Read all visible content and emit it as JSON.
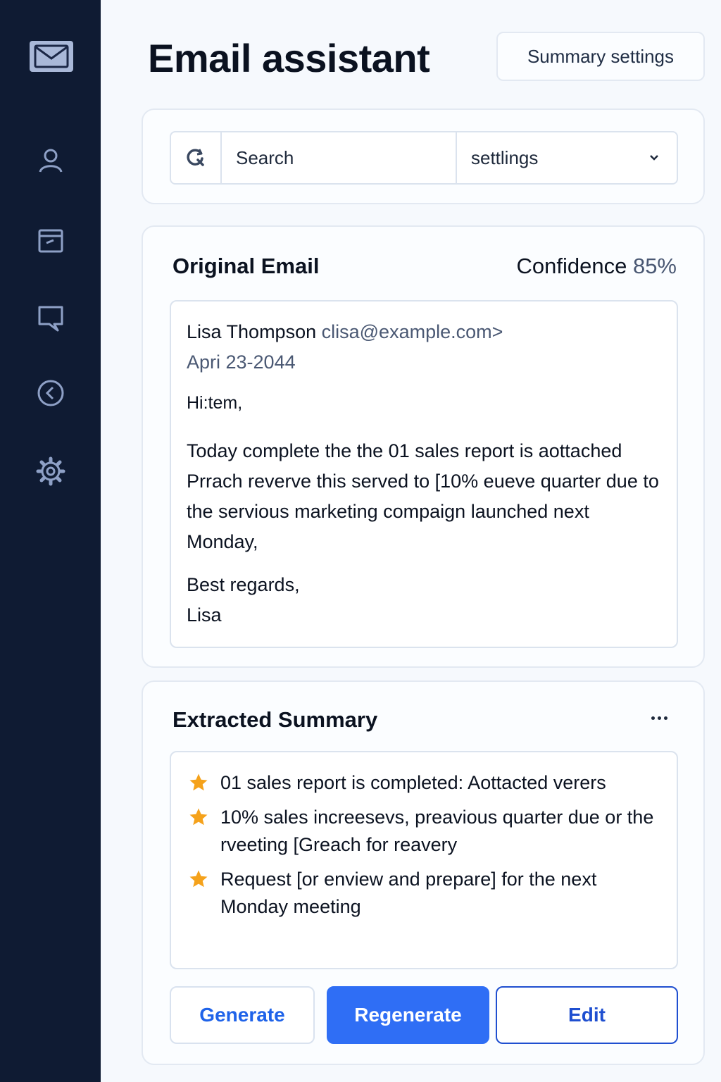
{
  "sidebar": {
    "logo_icon": "mail-icon",
    "items": [
      {
        "icon": "user-icon"
      },
      {
        "icon": "calendar-icon"
      },
      {
        "icon": "chat-icon"
      },
      {
        "icon": "back-arrow-icon"
      },
      {
        "icon": "gear-icon"
      }
    ]
  },
  "header": {
    "title": "Email assistant",
    "summary_settings_label": "Summary settings"
  },
  "search": {
    "placeholder": "Search",
    "settings_value": "settlings"
  },
  "original_email": {
    "title": "Original Email",
    "confidence_label": "Confidence",
    "confidence_value": "85%",
    "sender_name": "Lisa Thompson",
    "sender_address": "clisa@example.com>",
    "date": "Apri 23-2044",
    "greeting": "Hi:tem,",
    "body": "Today complete the the 01 sales report is aottached Prrach reverve this served to [10% eueve quarter due to the servious marketing compaign launched next Monday,",
    "signoff_1": "Best regards,",
    "signoff_2": "Lisa"
  },
  "summary": {
    "title": "Extracted Summary",
    "bullets": [
      "01 sales report is completed: Aottacted verers",
      "10% sales increesevs, preavious quarter due or the rveeting [Greach for reavery",
      "Request [or enview and prepare] for the next Monday meeting"
    ]
  },
  "actions": {
    "generate": "Generate",
    "regenerate": "Regenerate",
    "edit": "Edit"
  },
  "colors": {
    "sidebar_bg": "#0f1b33",
    "accent": "#2f6ef5",
    "star": "#f5a21b"
  }
}
